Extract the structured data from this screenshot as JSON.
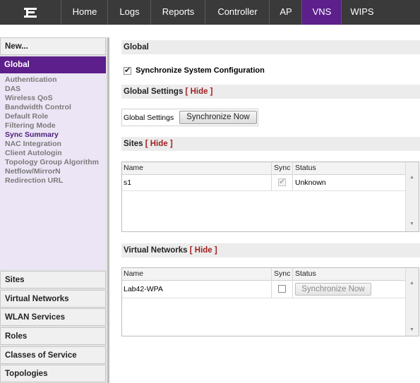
{
  "nav": {
    "logo_icon": "extreme-networks-logo",
    "tabs": [
      {
        "label": "Home",
        "active": false
      },
      {
        "label": "Logs",
        "active": false
      },
      {
        "label": "Reports",
        "active": false
      },
      {
        "label": "Controller",
        "active": false
      },
      {
        "label": "AP",
        "active": false
      },
      {
        "label": "VNS",
        "active": true
      },
      {
        "label": "WIPS",
        "active": false
      }
    ],
    "active_color": "#5c1f8c"
  },
  "sidebar": {
    "new_label": "New...",
    "global_label": "Global",
    "links": [
      "Authentication",
      "DAS",
      "Wireless QoS",
      "Bandwidth Control",
      "Default Role",
      "Filtering Mode",
      "Sync Summary",
      "NAC Integration",
      "Client Autologin",
      "Topology Group Algorithm",
      "Netflow/MirrorN",
      "Redirection URL"
    ],
    "current_link": "Sync Summary",
    "sections": [
      "Sites",
      "Virtual Networks",
      "WLAN Services",
      "Roles",
      "Classes of Service",
      "Topologies"
    ]
  },
  "main": {
    "global_title": "Global",
    "sync_system_label": "Synchronize System Configuration",
    "sync_system_checked": true,
    "global_settings": {
      "title": "Global Settings",
      "hide": "[ Hide ]",
      "row_label": "Global Settings",
      "button": "Synchronize Now"
    },
    "sites": {
      "title": "Sites",
      "hide": "[ Hide ]",
      "columns": [
        "Name",
        "Sync",
        "Status"
      ],
      "rows": [
        {
          "name": "s1",
          "sync": true,
          "status": "Unknown"
        }
      ]
    },
    "virtual_networks": {
      "title": "Virtual Networks",
      "hide": "[ Hide ]",
      "columns": [
        "Name",
        "Sync",
        "Status"
      ],
      "rows": [
        {
          "name": "Lab42-WPA",
          "sync": false,
          "status_button": "Synchronize Now"
        }
      ]
    }
  }
}
